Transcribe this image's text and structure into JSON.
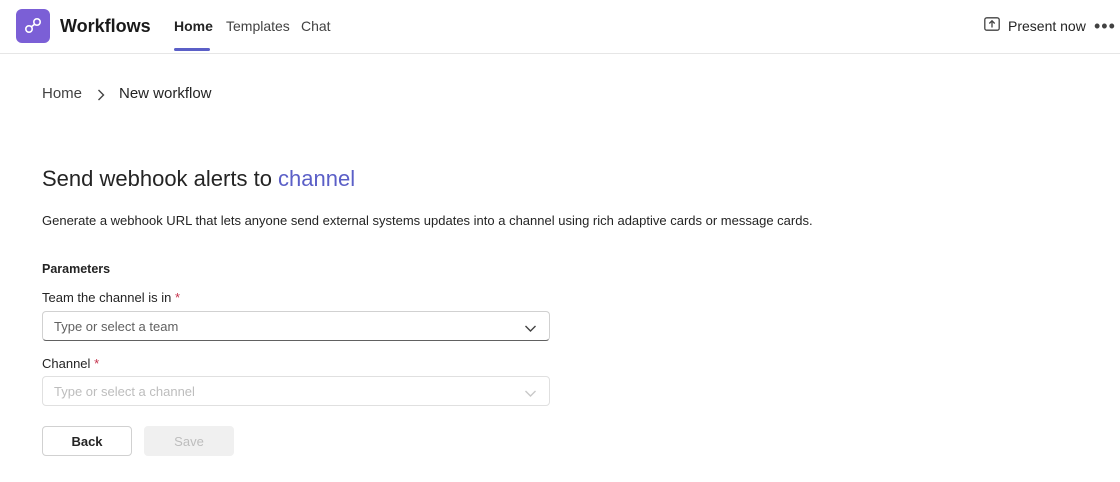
{
  "app": {
    "title": "Workflows",
    "icon": "workflows-icon",
    "accent_color": "#7b5fd6"
  },
  "tabs": [
    {
      "label": "Home",
      "active": true
    },
    {
      "label": "Templates",
      "active": false
    },
    {
      "label": "Chat",
      "active": false
    }
  ],
  "header_actions": {
    "present_label": "Present now",
    "present_icon": "present-icon",
    "more_label": "•••"
  },
  "breadcrumb": {
    "home": "Home",
    "current": "New workflow"
  },
  "main": {
    "title_prefix": "Send webhook alerts to ",
    "title_accent": "channel",
    "description": "Generate a webhook URL that lets anyone send external systems updates into a channel using rich adaptive cards or message cards.",
    "parameters_heading": "Parameters",
    "team_field": {
      "label": "Team the channel is in",
      "required_mark": "*",
      "placeholder": "Type or select a team"
    },
    "channel_field": {
      "label": "Channel",
      "required_mark": "*",
      "placeholder": "Type or select a channel",
      "disabled": true
    },
    "back_label": "Back",
    "save_label": "Save"
  },
  "colors": {
    "brand_accent": "#5b5fc7",
    "required": "#c4314b"
  }
}
